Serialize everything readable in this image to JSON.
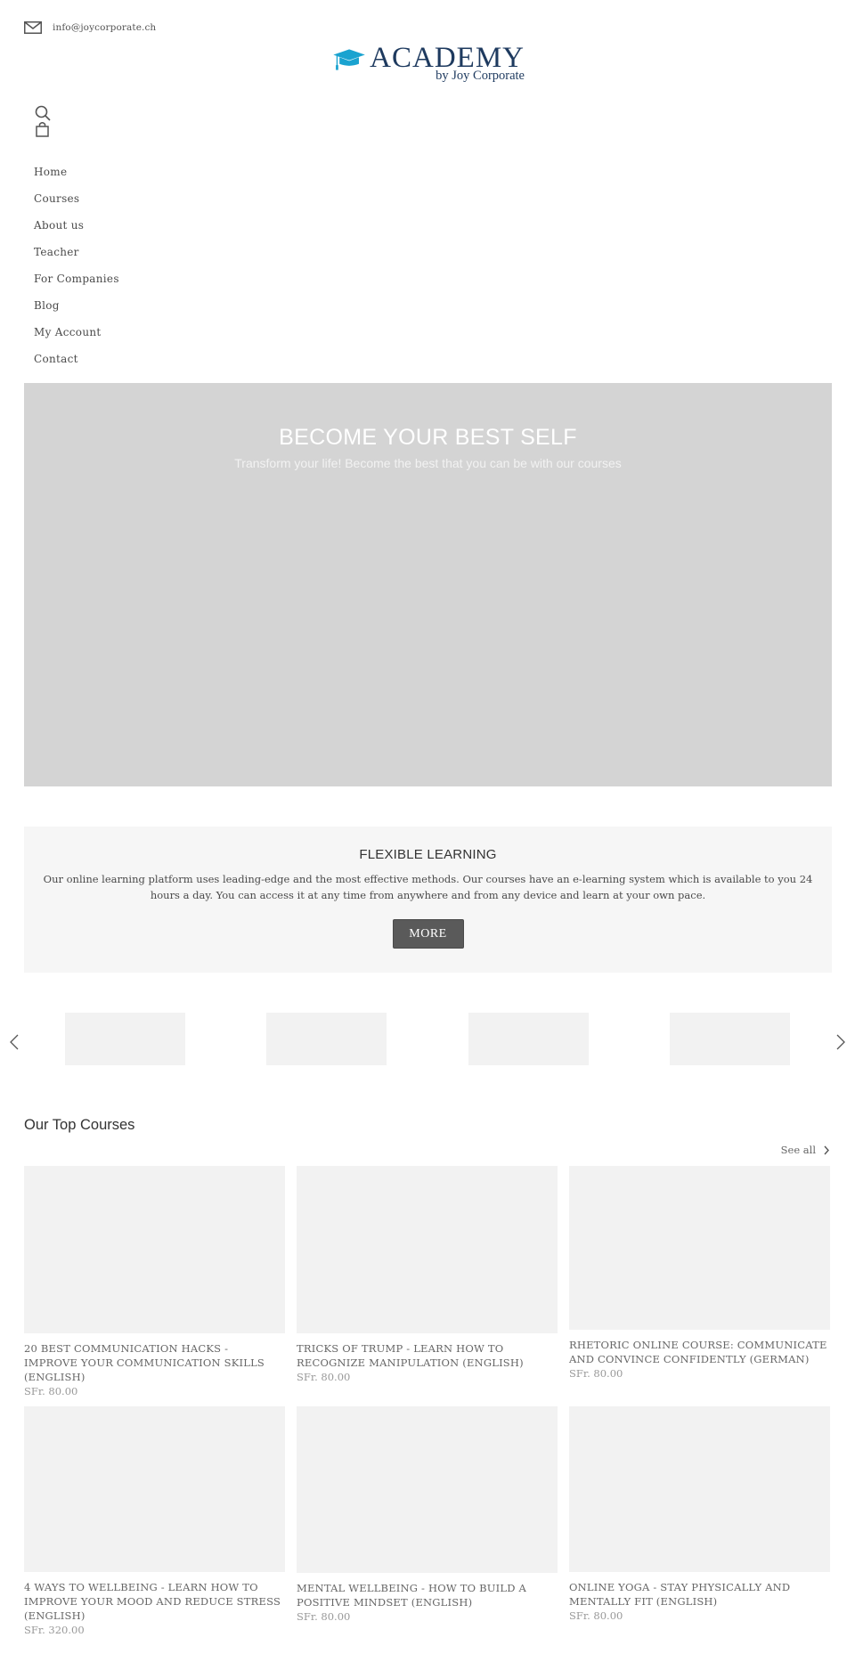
{
  "header": {
    "email": "info@joycorporate.ch",
    "logo": {
      "main": "ACADEMY",
      "sub": "by Joy Corporate",
      "cap_color": "#1aa3d0",
      "text_color": "#1e3a5f"
    },
    "icons": {
      "search": "search-icon",
      "cart": "shopping-bag-icon",
      "mail": "mail-icon"
    }
  },
  "nav": {
    "items": [
      {
        "label": "Home"
      },
      {
        "label": "Courses"
      },
      {
        "label": "About us"
      },
      {
        "label": "Teacher"
      },
      {
        "label": "For Companies"
      },
      {
        "label": "Blog"
      },
      {
        "label": "My Account"
      },
      {
        "label": "Contact"
      }
    ]
  },
  "hero": {
    "title": "BECOME YOUR BEST SELF",
    "subtitle": "Transform your life! Become the best that you can be with our courses"
  },
  "flexible": {
    "title": "FLEXIBLE LEARNING",
    "text": "Our online learning platform uses leading-edge and the most effective methods. Our courses have an e-learning system which is available to you 24 hours a day. You can access it at any time  from anywhere and from any device and learn at your own pace.",
    "button": "MORE"
  },
  "carousel": {
    "prev": "chevron-left-icon",
    "next": "chevron-right-icon",
    "slides": 4
  },
  "courses": {
    "title": "Our Top Courses",
    "see_all": "See all",
    "items": [
      {
        "title": "20 BEST COMMUNICATION HACKS - IMPROVE YOUR COMMUNICATION SKILLS (ENGLISH)",
        "price": "SFr. 80.00"
      },
      {
        "title": "TRICKS OF TRUMP - LEARN HOW TO RECOGNIZE MANIPULATION (ENGLISH)",
        "price": "SFr. 80.00"
      },
      {
        "title": "RHETORIC ONLINE COURSE: COMMUNICATE AND CONVINCE CONFIDENTLY (GERMAN)",
        "price": "SFr. 80.00"
      },
      {
        "title": "4 WAYS TO WELLBEING - LEARN HOW TO IMPROVE YOUR MOOD AND REDUCE STRESS (ENGLISH)",
        "price": "SFr. 320.00"
      },
      {
        "title": "MENTAL WELLBEING - HOW TO BUILD A POSITIVE MINDSET (ENGLISH)",
        "price": "SFr. 80.00"
      },
      {
        "title": "ONLINE YOGA - STAY PHYSICALLY AND MENTALLY FIT (ENGLISH)",
        "price": "SFr. 80.00"
      }
    ]
  }
}
